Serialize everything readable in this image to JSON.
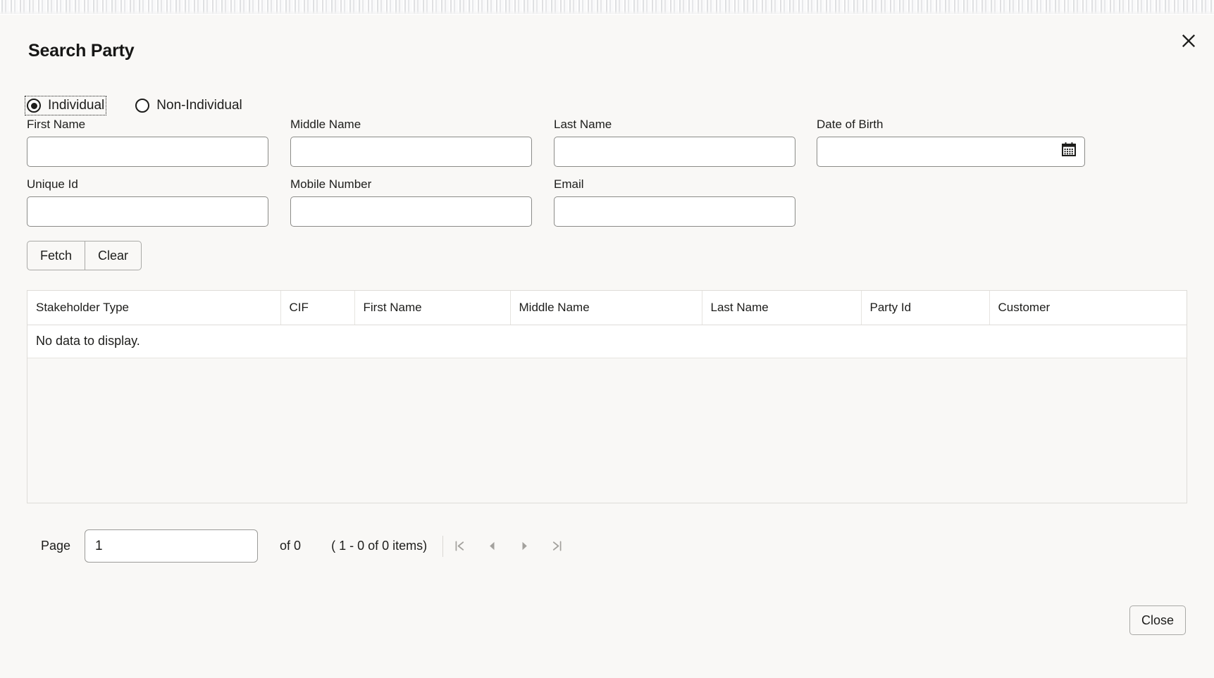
{
  "dialog": {
    "title": "Search Party",
    "close_icon": "close-x-icon"
  },
  "party_type": {
    "options": [
      {
        "label": "Individual",
        "selected": true
      },
      {
        "label": "Non-Individual",
        "selected": false
      }
    ]
  },
  "form": {
    "fields": [
      {
        "name": "first_name",
        "label": "First Name",
        "value": "",
        "placeholder": ""
      },
      {
        "name": "middle_name",
        "label": "Middle Name",
        "value": "",
        "placeholder": ""
      },
      {
        "name": "last_name",
        "label": "Last Name",
        "value": "",
        "placeholder": ""
      },
      {
        "name": "date_of_birth",
        "label": "Date of Birth",
        "value": "",
        "placeholder": "",
        "icon": "calendar-icon"
      },
      {
        "name": "unique_id",
        "label": "Unique Id",
        "value": "",
        "placeholder": ""
      },
      {
        "name": "mobile_number",
        "label": "Mobile Number",
        "value": "",
        "placeholder": ""
      },
      {
        "name": "email",
        "label": "Email",
        "value": "",
        "placeholder": ""
      }
    ],
    "buttons": {
      "fetch": "Fetch",
      "clear": "Clear"
    }
  },
  "table": {
    "columns": [
      "Stakeholder Type",
      "CIF",
      "First Name",
      "Middle Name",
      "Last Name",
      "Party Id",
      "Customer"
    ],
    "rows": [],
    "empty_message": "No data to display."
  },
  "pagination": {
    "page_word": "Page",
    "page_value": "1",
    "of_total": "of 0",
    "range_text": "( 1 - 0 of 0 items)",
    "nav": [
      {
        "name": "first-page",
        "glyph": "|‹"
      },
      {
        "name": "previous-page",
        "glyph": "◂"
      },
      {
        "name": "next-page",
        "glyph": "▸"
      },
      {
        "name": "last-page",
        "glyph": "›|"
      }
    ]
  },
  "footer": {
    "close_label": "Close"
  },
  "colors": {
    "background": "#f9f8f6",
    "surface": "#ffffff",
    "text": "#1d1d1b",
    "border": "#8b8b88",
    "grid_border": "#dedcd8",
    "muted": "#a3a19d"
  }
}
